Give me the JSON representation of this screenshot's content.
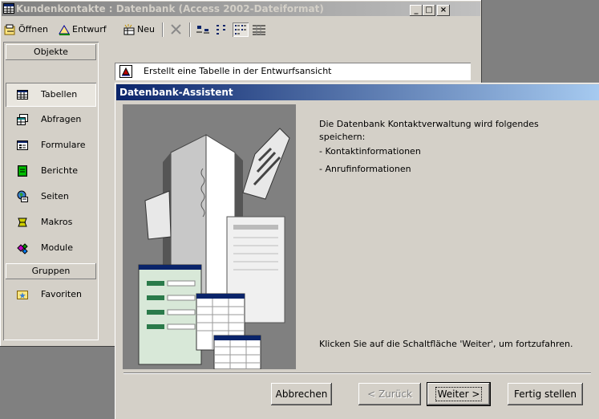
{
  "db_window": {
    "title": "Kundenkontakte : Datenbank (Access 2002-Dateiformat)",
    "controls": {
      "minimize": "_",
      "maximize": "□",
      "close": "×"
    }
  },
  "toolbar": {
    "open_label": "Öffnen",
    "design_label": "Entwurf",
    "new_label": "Neu"
  },
  "objects_bar": {
    "header": "Objekte",
    "items": [
      {
        "label": "Tabellen",
        "icon": "table-icon",
        "selected": true
      },
      {
        "label": "Abfragen",
        "icon": "query-icon"
      },
      {
        "label": "Formulare",
        "icon": "form-icon"
      },
      {
        "label": "Berichte",
        "icon": "report-icon"
      },
      {
        "label": "Seiten",
        "icon": "page-icon"
      },
      {
        "label": "Makros",
        "icon": "macro-icon"
      },
      {
        "label": "Module",
        "icon": "module-icon"
      }
    ],
    "groups_header": "Gruppen",
    "groups": [
      {
        "label": "Favoriten",
        "icon": "favorites-icon"
      }
    ]
  },
  "hint_row": {
    "text": "Erstellt eine Tabelle in der Entwurfsansicht"
  },
  "wizard": {
    "title": "Datenbank-Assistent",
    "intro": "Die Datenbank Kontaktverwaltung wird folgendes speichern:",
    "items": [
      "-  Kontaktinformationen",
      "-  Anrufinformationen"
    ],
    "footer": "Klicken Sie auf die Schaltfläche 'Weiter', um fortzufahren.",
    "buttons": {
      "cancel": "Abbrechen",
      "back": "< Zurück",
      "next": "Weiter >",
      "finish": "Fertig stellen"
    }
  },
  "colors": {
    "face": "#d4d0c8",
    "active_caption": "#0a246a",
    "inactive_caption": "#808080"
  }
}
